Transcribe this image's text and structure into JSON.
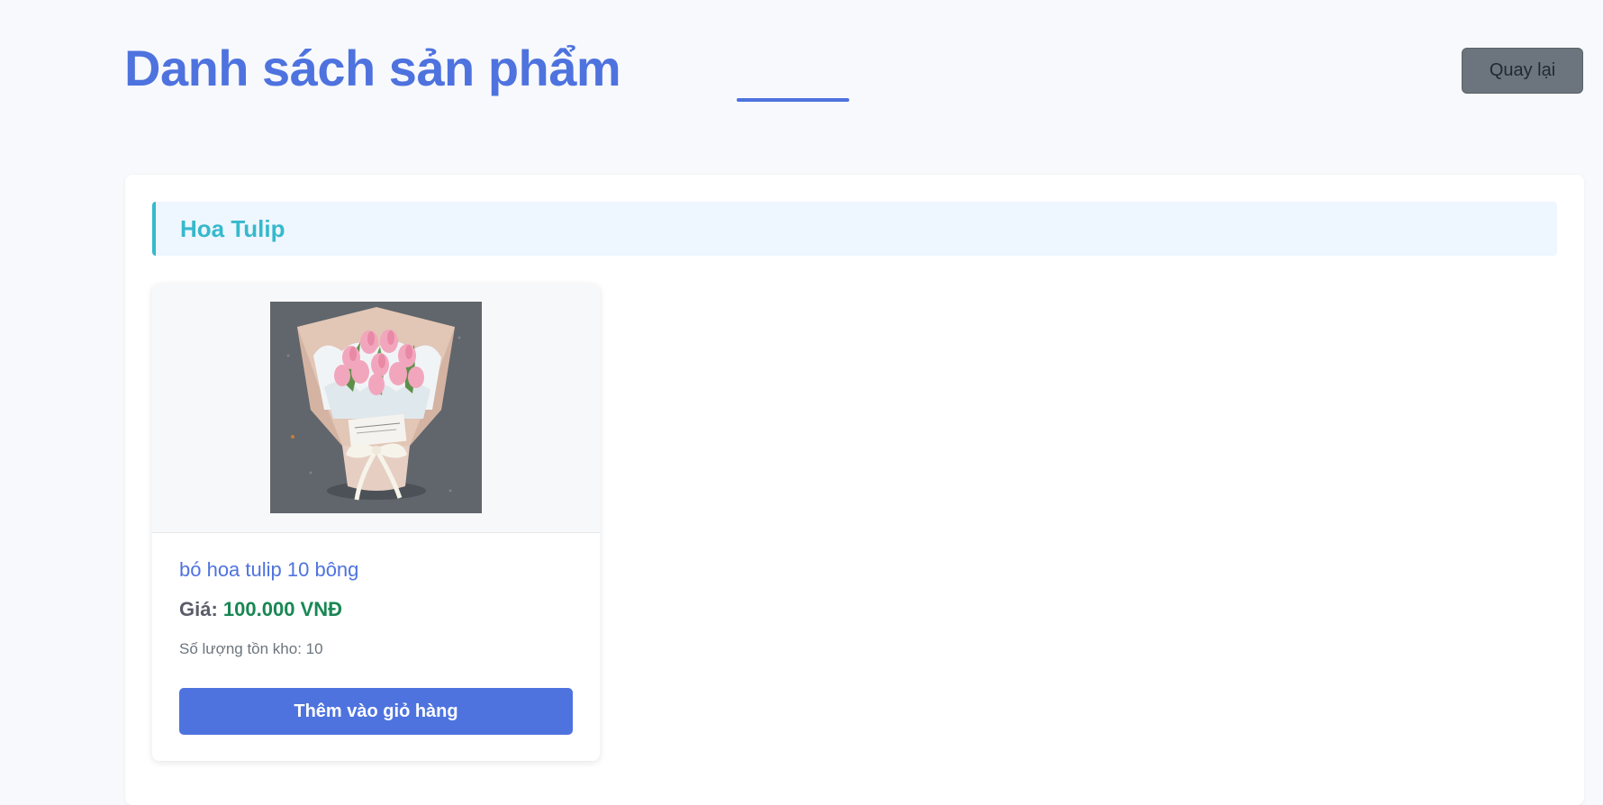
{
  "header": {
    "title": "Danh sách sản phẩm",
    "back_label": "Quay lại"
  },
  "category": {
    "name": "Hoa Tulip"
  },
  "product": {
    "image_icon": "tulip-bouquet-photo",
    "name": "bó hoa tulip 10 bông",
    "price_label": "Giá:",
    "price_value": "100.000 VNĐ",
    "stock_text": "Số lượng tồn kho: 10",
    "add_to_cart_label": "Thêm vào giỏ hàng"
  },
  "colors": {
    "primary": "#4e73df",
    "info": "#36b9cc",
    "success": "#198754",
    "secondary": "#6c757d",
    "background": "#f8f9fc"
  }
}
